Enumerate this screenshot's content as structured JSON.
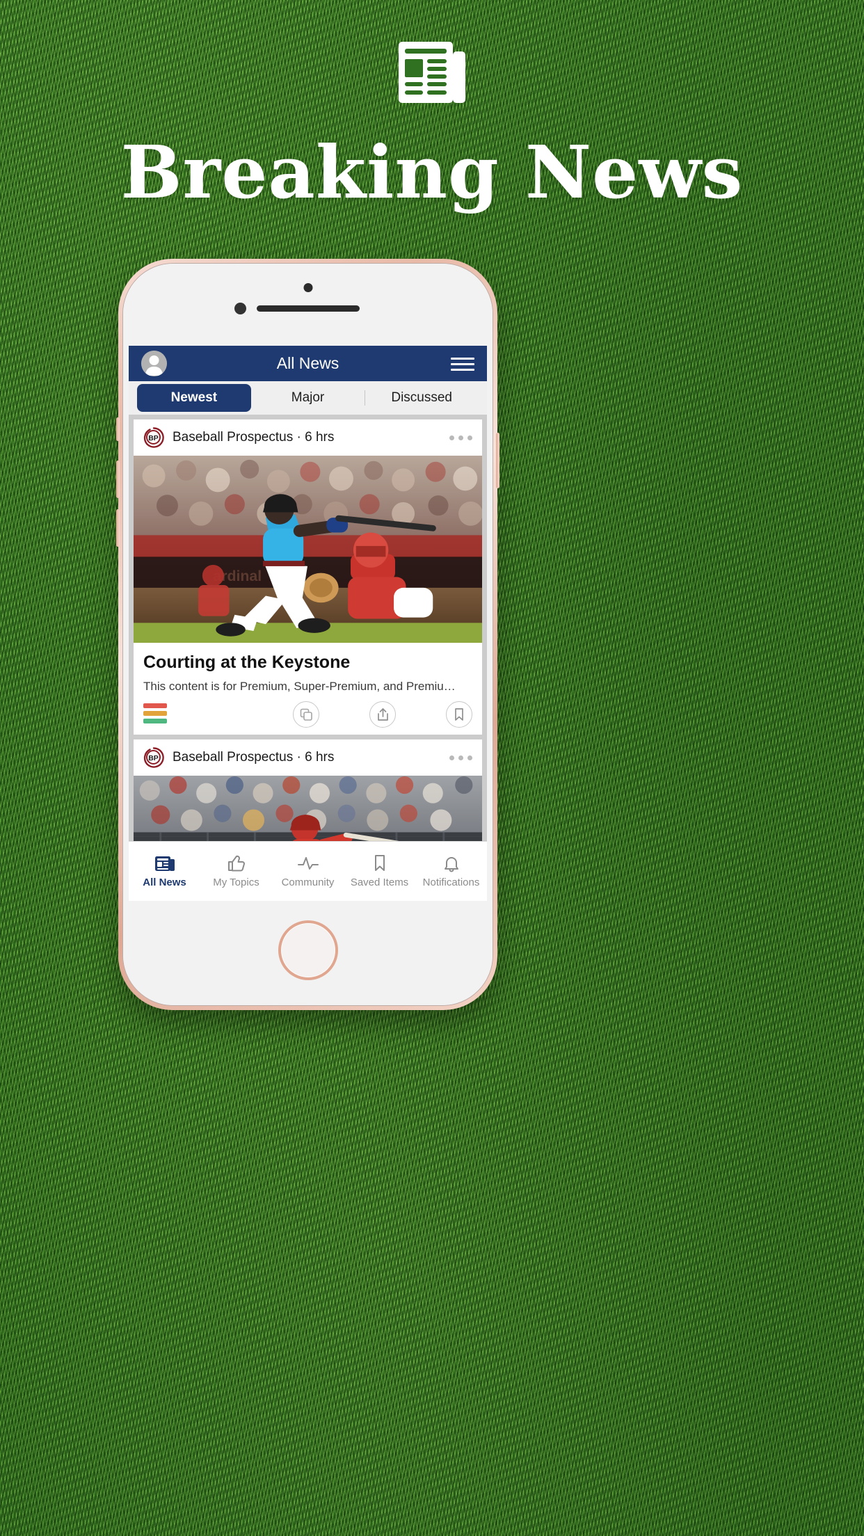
{
  "hero": {
    "title": "Breaking News",
    "icon": "newspaper-icon"
  },
  "app": {
    "navbar": {
      "title": "All News",
      "avatar_icon": "user-avatar-icon",
      "menu_icon": "hamburger-menu-icon"
    },
    "segments": [
      {
        "label": "Newest",
        "active": true
      },
      {
        "label": "Major",
        "active": false
      },
      {
        "label": "Discussed",
        "active": false
      }
    ],
    "cards": [
      {
        "source": "Baseball Prospectus",
        "separator": "·",
        "time": "6 hrs",
        "source_line": "Baseball Prospectus · 6 hrs",
        "logo_text": "BP",
        "title": "Courting at the Keystone",
        "description": "This content is for Premium, Super-Premium, and Premiu…",
        "overflow_icon": "more-options-icon",
        "actions": {
          "rating_bars": [
            "#e2574c",
            "#e2a43a",
            "#4fb780"
          ],
          "copy_icon": "copy-icon",
          "share_icon": "share-icon",
          "bookmark_icon": "bookmark-icon"
        },
        "image_alt": "baseball batter swinging with catcher"
      },
      {
        "source": "Baseball Prospectus",
        "separator": "·",
        "time": "6 hrs",
        "source_line": "Baseball Prospectus · 6 hrs",
        "logo_text": "BP",
        "overflow_icon": "more-options-icon",
        "image_alt": "baseball batter at plate in red uniform"
      }
    ],
    "tabbar": [
      {
        "label": "All News",
        "icon": "newspaper-icon",
        "active": true
      },
      {
        "label": "My Topics",
        "icon": "thumbs-up-icon",
        "active": false
      },
      {
        "label": "Community",
        "icon": "pulse-icon",
        "active": false
      },
      {
        "label": "Saved Items",
        "icon": "bookmark-icon",
        "active": false
      },
      {
        "label": "Notifications",
        "icon": "bell-icon",
        "active": false
      }
    ]
  },
  "colors": {
    "brand_navy": "#1e3a70",
    "grass_green": "#2f7021",
    "card_white": "#ffffff",
    "feed_gray": "#cccccc"
  }
}
